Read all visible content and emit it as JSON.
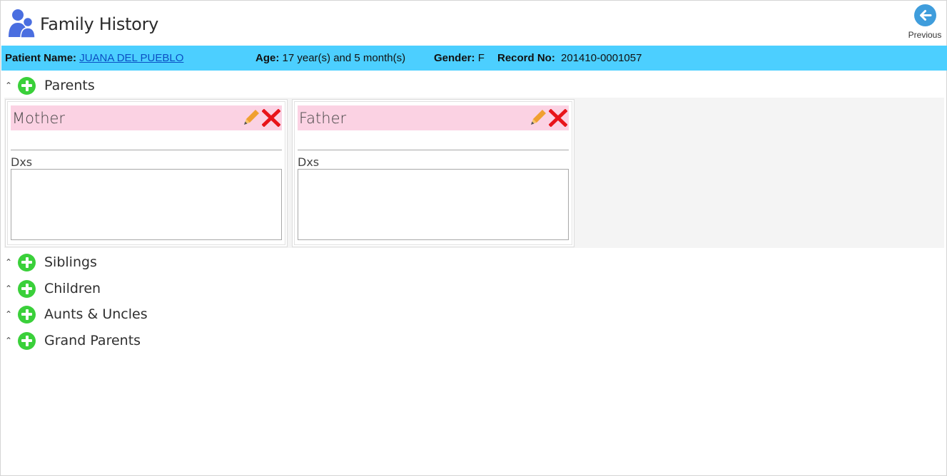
{
  "header": {
    "title": "Family History",
    "previous_label": "Previous"
  },
  "patient": {
    "name_label": "Patient Name:",
    "name": "JUANA DEL PUEBLO ",
    "age_label": "Age:",
    "age": "17 year(s) and 5 month(s)",
    "gender_label": "Gender:",
    "gender": "F",
    "record_label": "Record No:",
    "record": "201410-0001057"
  },
  "sections": {
    "parents": "Parents",
    "siblings": "Siblings",
    "children": "Children",
    "aunts_uncles": "Aunts & Uncles",
    "grand_parents": "Grand Parents"
  },
  "cards": [
    {
      "name": "Mother",
      "dxs_label": "Dxs",
      "dxs_value": ""
    },
    {
      "name": "Father",
      "dxs_label": "Dxs",
      "dxs_value": ""
    }
  ],
  "colors": {
    "accent_bar": "#4ccfff",
    "add_green": "#3ad03a",
    "card_header_pink": "#fbd2e3",
    "edit_orange": "#f0a030",
    "delete_red": "#e8141a",
    "previous_blue": "#3f9ddc"
  },
  "icons": {
    "app": "family-users-icon",
    "previous": "arrow-left-icon",
    "add": "plus-circle-icon",
    "edit": "pencil-icon",
    "delete": "x-icon",
    "collapse": "chevron-up-icon"
  }
}
